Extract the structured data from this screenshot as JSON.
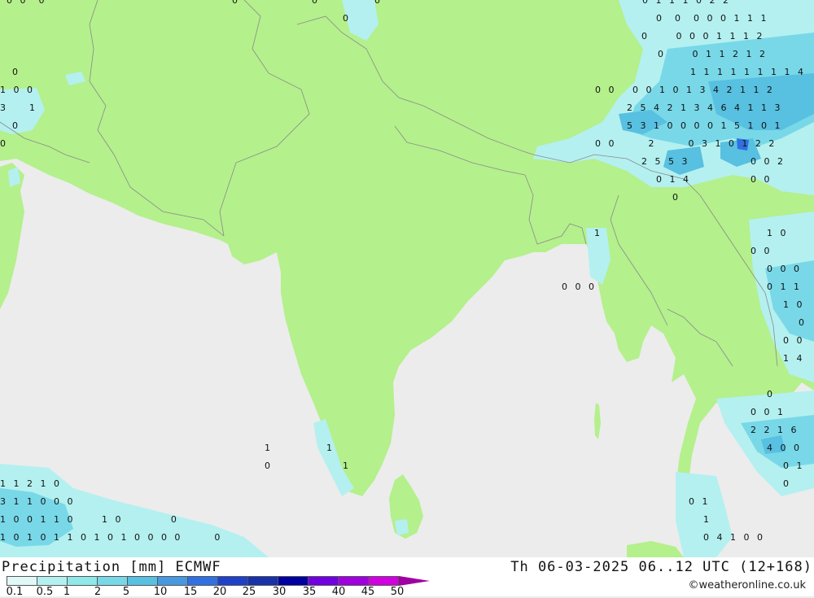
{
  "header": {
    "title": "Precipitation [mm] ECMWF",
    "run": "Th 06-03-2025 06..12 UTC (12+168)",
    "credit": "©weatheronline.co.uk"
  },
  "legend": {
    "labels": [
      "0.1",
      "0.5",
      "1",
      "2",
      "5",
      "10",
      "15",
      "20",
      "25",
      "30",
      "35",
      "40",
      "45",
      "50"
    ],
    "colors": [
      "#e0f8f8",
      "#b4f0f0",
      "#90e8e8",
      "#78d8e8",
      "#58c0e0",
      "#4898e0",
      "#3070e0",
      "#2040c8",
      "#1830a8",
      "#0000a0",
      "#7000e0",
      "#a000e0",
      "#d000e0",
      "#e000c8"
    ],
    "arrow_color": "#a000a0"
  },
  "map": {
    "land_color": "#b4f08c",
    "sea_color": "#ececec",
    "border_color": "#8a8a8a"
  },
  "values": [
    {
      "id": "v1",
      "text": "0"
    },
    {
      "id": "v2",
      "text": "0"
    },
    {
      "id": "v3",
      "text": "0"
    },
    {
      "id": "v4",
      "text": "0"
    },
    {
      "id": "v5",
      "text": "0 1 1 1 0 2 2"
    },
    {
      "id": "v6",
      "text": "0  0  0 0 0 1 1 1"
    },
    {
      "id": "v7",
      "text": "0     0 0 0 1 1 1 2"
    },
    {
      "id": "v8",
      "text": "0     0 1 1 2 1 2"
    },
    {
      "id": "v9",
      "text": "1 1 1 1 1 1 1 1 4"
    },
    {
      "id": "v10",
      "text": "0 0   0 0 1 0 1 3 4 2 1 1 2"
    },
    {
      "id": "v11",
      "text": "2 5 4 2 1 3 4 6 4 1 1 3"
    },
    {
      "id": "v12",
      "text": "5 3 1 0 0 0 0 1 5 1 0 1"
    },
    {
      "id": "v13",
      "text": "0 0      2      0 3 1 0 1 2 2"
    },
    {
      "id": "v14",
      "text": "2 5 5 3"
    },
    {
      "id": "v15",
      "text": "0 0 2"
    },
    {
      "id": "v16",
      "text": "0 1 4"
    },
    {
      "id": "v17",
      "text": "0 0"
    },
    {
      "id": "v18",
      "text": "0"
    },
    {
      "id": "v19",
      "text": "0"
    },
    {
      "id": "v20",
      "text": "1 0 0"
    },
    {
      "id": "v21",
      "text": "3    1"
    },
    {
      "id": "v22",
      "text": "0"
    },
    {
      "id": "v23",
      "text": "0"
    },
    {
      "id": "v24",
      "text": "1"
    },
    {
      "id": "v25",
      "text": "1 0"
    },
    {
      "id": "v26",
      "text": "0 0"
    },
    {
      "id": "v27",
      "text": "0 0 0"
    },
    {
      "id": "v28",
      "text": "0 1 1"
    },
    {
      "id": "v29",
      "text": "1 0"
    },
    {
      "id": "v30",
      "text": "0"
    },
    {
      "id": "v31",
      "text": "0 0"
    },
    {
      "id": "v32",
      "text": "1 4"
    },
    {
      "id": "v33",
      "text": "0 0 0"
    },
    {
      "id": "v34",
      "text": "0"
    },
    {
      "id": "v35",
      "text": "0 0 1"
    },
    {
      "id": "v36",
      "text": "2 2 1 6"
    },
    {
      "id": "v37",
      "text": "4 0 0"
    },
    {
      "id": "v38",
      "text": "0 1"
    },
    {
      "id": "v39",
      "text": "0"
    },
    {
      "id": "v40",
      "text": "1"
    },
    {
      "id": "v41",
      "text": "0"
    },
    {
      "id": "v42",
      "text": "1"
    },
    {
      "id": "v43",
      "text": "1"
    },
    {
      "id": "v44",
      "text": "1 1 2 1 0"
    },
    {
      "id": "v45",
      "text": "3 1 1 0 0 0"
    },
    {
      "id": "v46",
      "text": "1 0 0 1 1 0     1 0         0"
    },
    {
      "id": "v47",
      "text": "1 0 1 0 1 1 0 1 0 1 0 0 0 0      0"
    },
    {
      "id": "v48",
      "text": "0 1"
    },
    {
      "id": "v49",
      "text": "1"
    },
    {
      "id": "v50",
      "text": "0 4 1 0 0"
    },
    {
      "id": "v51",
      "text": "0 0  0"
    }
  ]
}
